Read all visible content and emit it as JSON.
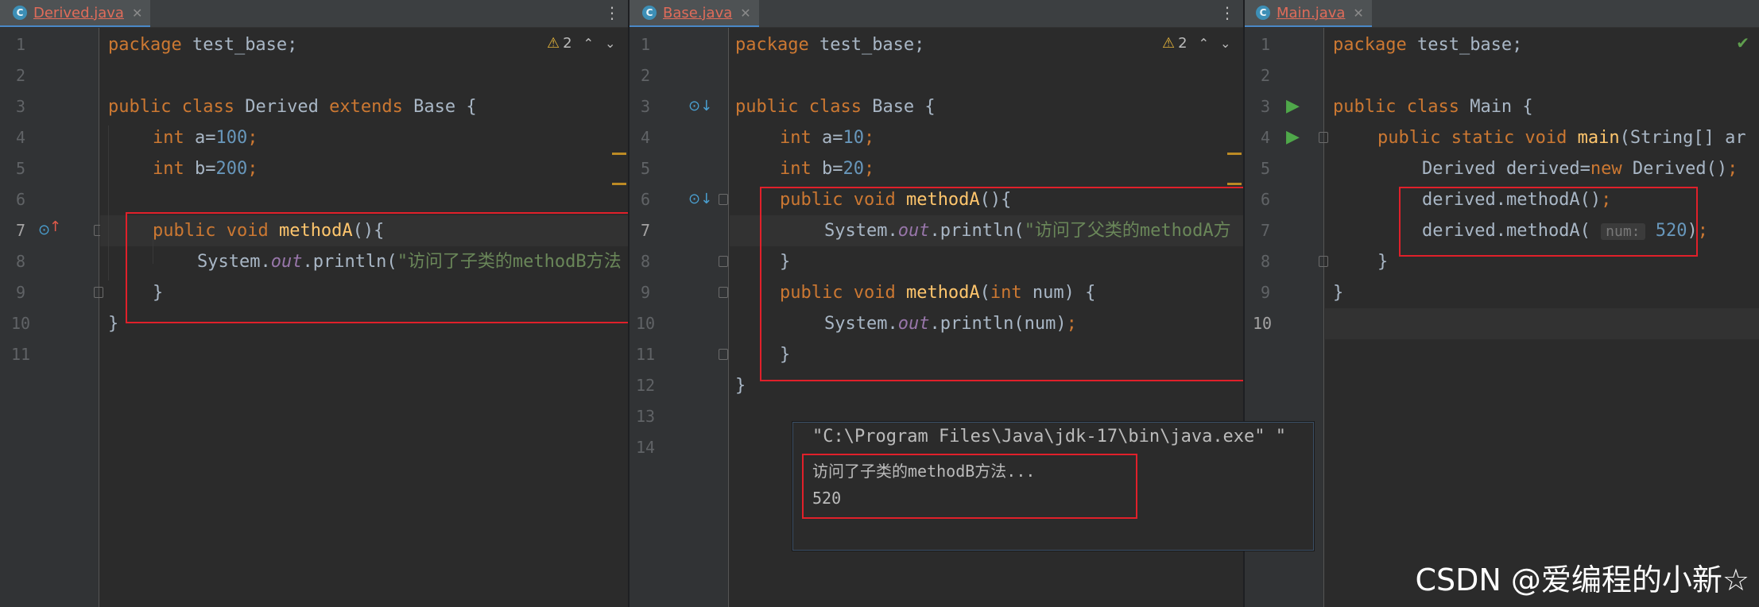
{
  "panes": [
    {
      "tab": {
        "icon": "C",
        "name": "Derived.java"
      },
      "warning_count": "2",
      "line_numbers": [
        "1",
        "2",
        "3",
        "4",
        "5",
        "6",
        "7",
        "8",
        "9",
        "10",
        "11"
      ],
      "current_line": "7",
      "code": {
        "l1_kw": "package",
        "l1_rest": " test_base;",
        "l3_kw1": "public class",
        "l3_name": " Derived ",
        "l3_kw2": "extends",
        "l3_rest": " Base {",
        "l4_kw": "int",
        "l4_var": " a=",
        "l4_num": "100",
        "l4_end": ";",
        "l5_kw": "int",
        "l5_var": " b=",
        "l5_num": "200",
        "l5_end": ";",
        "l7_kw": "public void",
        "l7_fn": "methodA",
        "l7_rest": "(){",
        "l8_a": "System.",
        "l8_fld": "out",
        "l8_b": ".println(",
        "l8_str": "\"访问了子类的methodB方法",
        "l9": "}",
        "l10": "}"
      }
    },
    {
      "tab": {
        "icon": "C",
        "name": "Base.java"
      },
      "warning_count": "2",
      "line_numbers": [
        "1",
        "2",
        "3",
        "4",
        "5",
        "6",
        "7",
        "8",
        "9",
        "10",
        "11",
        "12",
        "13",
        "14"
      ],
      "current_line": "7",
      "code": {
        "l1_kw": "package",
        "l1_rest": " test_base;",
        "l3_kw": "public class",
        "l3_rest": " Base {",
        "l4_kw": "int",
        "l4_var": " a=",
        "l4_num": "10",
        "l4_end": ";",
        "l5_kw": "int",
        "l5_var": " b=",
        "l5_num": "20",
        "l5_end": ";",
        "l6_kw": "public void",
        "l6_fn": "methodA",
        "l6_rest": "(){",
        "l7_a": "System.",
        "l7_fld": "out",
        "l7_b": ".println(",
        "l7_str": "\"访问了父类的methodA方",
        "l8": "}",
        "l9_kw": "public void",
        "l9_fn": "methodA",
        "l9_p": "(",
        "l9_kw2": "int",
        "l9_rest": " num) {",
        "l10_a": "System.",
        "l10_fld": "out",
        "l10_b": ".println(num)",
        "l10_end": ";",
        "l11": "}",
        "l12": "}"
      }
    },
    {
      "tab": {
        "icon": "C",
        "name": "Main.java"
      },
      "status_icon": "check-icon",
      "line_numbers": [
        "1",
        "2",
        "3",
        "4",
        "5",
        "6",
        "7",
        "8",
        "9",
        "10"
      ],
      "current_line": "10",
      "code": {
        "l1_kw": "package",
        "l1_rest": " test_base;",
        "l3_kw": "public class",
        "l3_rest": " Main {",
        "l4_kw": "public static void",
        "l4_fn": "main",
        "l4_rest": "(String[] ar",
        "l5_a": "Derived derived=",
        "l5_kw": "new",
        "l5_b": " Derived()",
        "l5_end": ";",
        "l6_a": "derived.methodA()",
        "l6_end": ";",
        "l7_a": "derived.methodA( ",
        "l7_hint": "num:",
        "l7_num": "520",
        "l7_b": ")",
        "l7_end": ";",
        "l8": "}",
        "l9": "}"
      }
    }
  ],
  "console": {
    "command": "\"C:\\Program Files\\Java\\jdk-17\\bin\\java.exe\" \"",
    "output": [
      "访问了子类的methodB方法...",
      "520"
    ]
  },
  "watermark": "CSDN @爱编程的小新☆",
  "colors": {
    "keyword": "#cc7832",
    "function": "#ffc66d",
    "number": "#6897bb",
    "string": "#6a8759",
    "field": "#9876aa",
    "highlight_box": "#e0202a"
  }
}
